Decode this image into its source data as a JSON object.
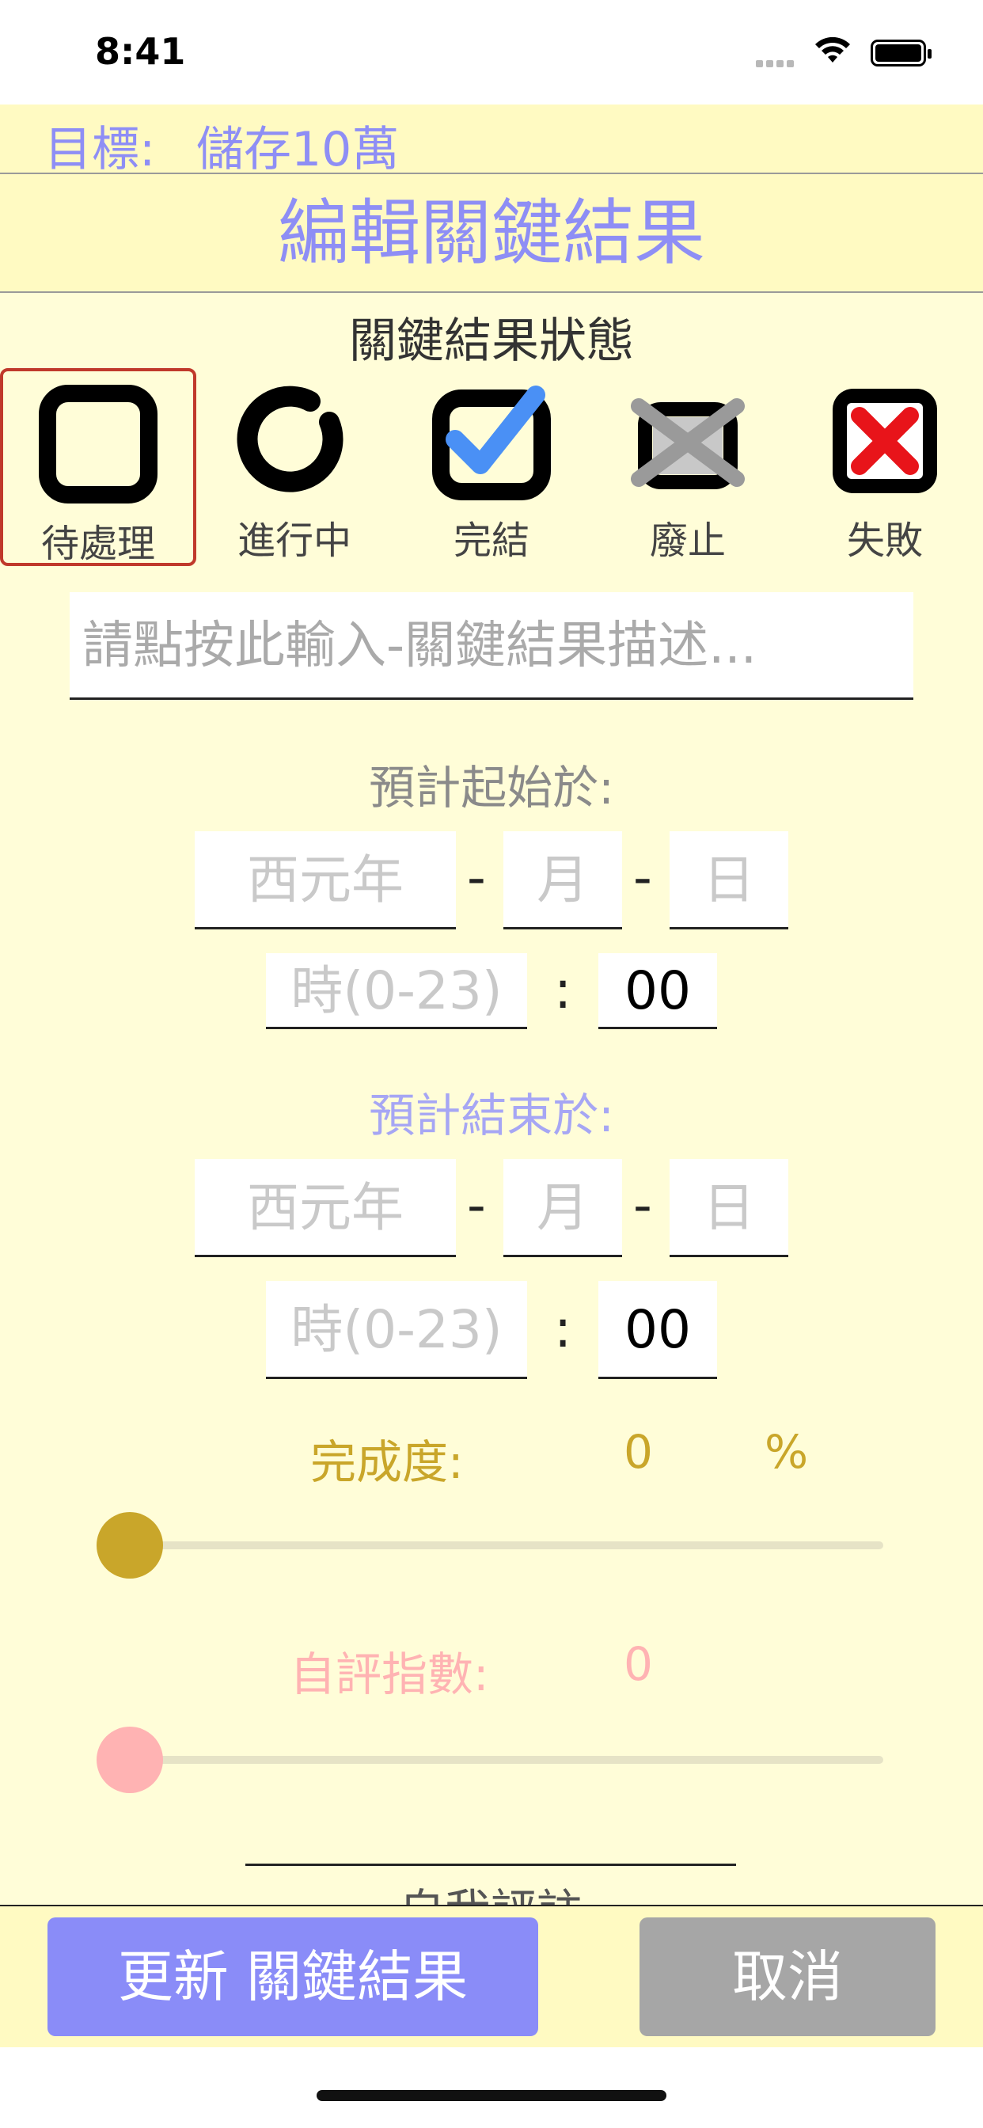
{
  "status_bar": {
    "time": "8:41"
  },
  "goal": {
    "label": "目標:",
    "value": "儲存10萬"
  },
  "page_title": "編輯關鍵結果",
  "status_section": {
    "title": "關鍵結果狀態",
    "items": [
      {
        "label": "待處理",
        "icon": "empty-checkbox-icon",
        "selected": true
      },
      {
        "label": "進行中",
        "icon": "in-progress-circle-icon",
        "selected": false
      },
      {
        "label": "完結",
        "icon": "checked-checkbox-icon",
        "selected": false
      },
      {
        "label": "廢止",
        "icon": "crossed-out-checkbox-icon",
        "selected": false
      },
      {
        "label": "失敗",
        "icon": "red-x-checkbox-icon",
        "selected": false
      }
    ],
    "selected_color": "#c0392b"
  },
  "description": {
    "placeholder": "請點按此輸入-關鍵結果描述..."
  },
  "start": {
    "label": "預計起始於:",
    "year_placeholder": "西元年",
    "month_placeholder": "月",
    "day_placeholder": "日",
    "hour_placeholder": "時(0-23)",
    "minute_value": "00",
    "date_sep": "-",
    "time_sep": ":"
  },
  "end": {
    "label": "預計結束於:",
    "year_placeholder": "西元年",
    "month_placeholder": "月",
    "day_placeholder": "日",
    "hour_placeholder": "時(0-23)",
    "minute_value": "00",
    "date_sep": "-",
    "time_sep": ":"
  },
  "progress": {
    "label": "完成度:",
    "value": "0",
    "unit": "%",
    "fraction": 0,
    "color": "#c9a62a"
  },
  "self_score": {
    "label": "自評指數:",
    "value": "0",
    "fraction": 0,
    "color": "#ffb3b3"
  },
  "self_evaluation": {
    "label": "自我評註"
  },
  "footer": {
    "update_label": "更新 關鍵結果",
    "cancel_label": "取消"
  },
  "colors": {
    "accent": "#8e8ef5",
    "header_bg": "#fffac2",
    "content_bg": "#fffdd8",
    "update_button": "#8a8cf8",
    "cancel_button": "#a6a6a6"
  }
}
